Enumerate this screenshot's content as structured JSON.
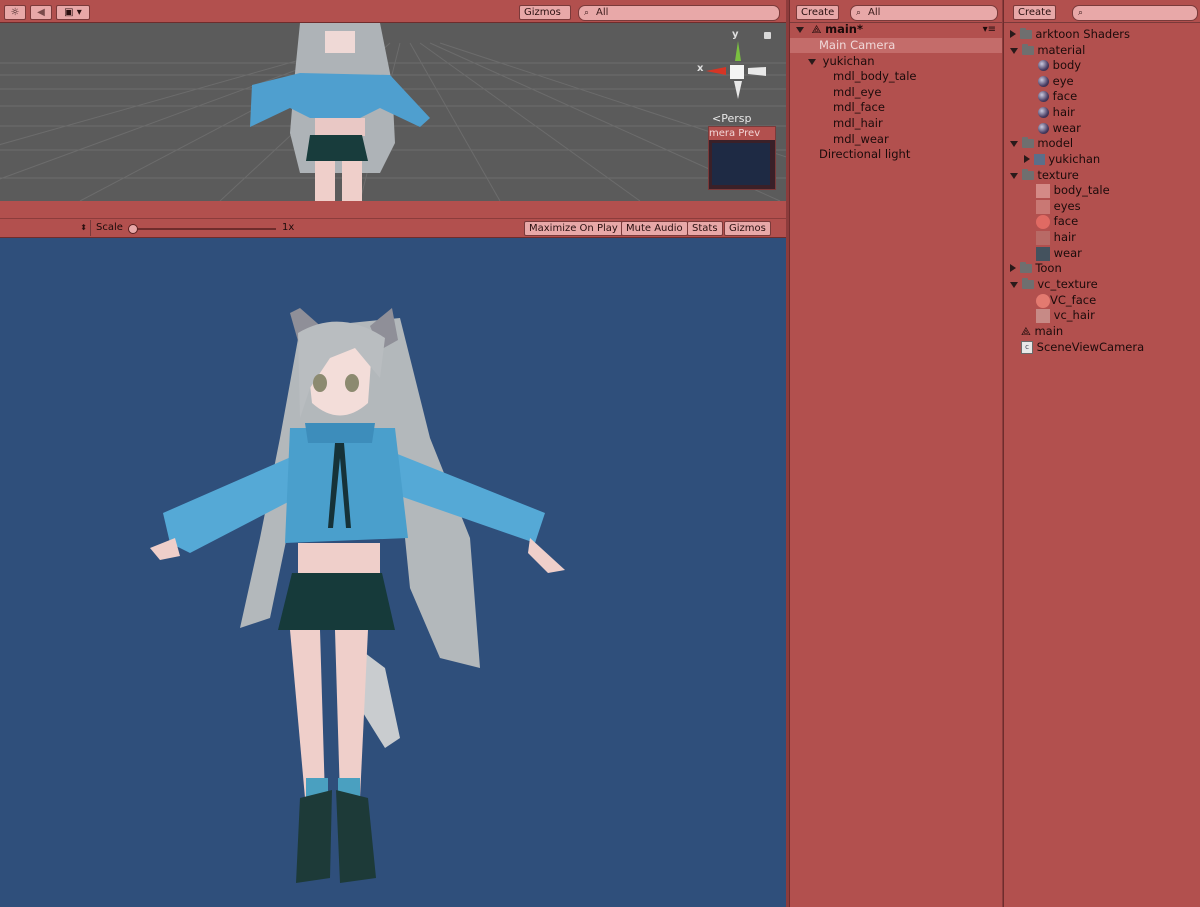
{
  "scene": {
    "gizmos_label": "Gizmos",
    "search_placeholder": "All",
    "persp_label": "Persp",
    "camera_preview_label": "mera Prev",
    "axis_x": "x",
    "axis_y": "y"
  },
  "game": {
    "scale_label": "Scale",
    "scale_value": "1x",
    "buttons": [
      "Maximize On Play",
      "Mute Audio",
      "Stats",
      "Gizmos"
    ]
  },
  "hierarchy": {
    "create_label": "Create",
    "search_placeholder": "All",
    "scene_name": "main*",
    "items": [
      "Main Camera",
      "yukichan",
      "mdl_body_tale",
      "mdl_eye",
      "mdl_face",
      "mdl_hair",
      "mdl_wear",
      "Directional light"
    ]
  },
  "project": {
    "create_label": "Create",
    "items": [
      "arktoon Shaders",
      "material",
      "body",
      "eye",
      "face",
      "hair",
      "wear",
      "model",
      "yukichan",
      "texture",
      "body_tale",
      "eyes",
      "face",
      "hair",
      "wear",
      "Toon",
      "vc_texture",
      "VC_face",
      "vc_hair",
      "main",
      "SceneViewCamera"
    ]
  },
  "colors": {
    "panel": "#b2504e",
    "game_bg": "#2f4f7b",
    "scene_bg": "#5b5b5b"
  }
}
